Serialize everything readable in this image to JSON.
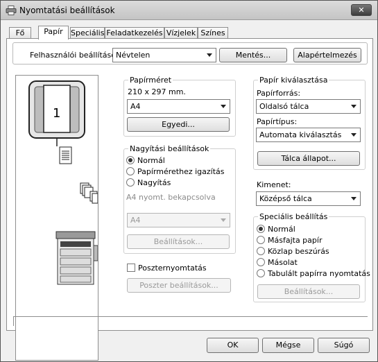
{
  "window": {
    "title": "Nyomtatási beállítások",
    "close_glyph": "✕"
  },
  "tabs": [
    "Fő",
    "Papír",
    "Speciális",
    "Feladatkezelés",
    "Vízjelek",
    "Színes"
  ],
  "user_settings": {
    "label": "Felhasználói beállítások:",
    "value": "Névtelen",
    "save_label": "Mentés...",
    "default_label": "Alapértelmezés"
  },
  "preview": {
    "page_number": "1"
  },
  "paper_size": {
    "title": "Papírméret",
    "dimensions": "210 x 297 mm.",
    "value": "A4",
    "custom_label": "Egyedi..."
  },
  "zoom": {
    "title": "Nagyítási beállítások",
    "options": [
      "Normál",
      "Papírmérethez igazítás",
      "Nagyítás"
    ],
    "selected": "Normál",
    "status": "A4 nyomt. bekapcsolva",
    "size_value": "A4",
    "settings_label": "Beállítások..."
  },
  "poster": {
    "checkbox_label": "Poszternyomtatás",
    "settings_label": "Poszter beállítások..."
  },
  "paper_selection": {
    "title": "Papír kiválasztása",
    "source_label": "Papírforrás:",
    "source_value": "Oldalsó tálca",
    "type_label": "Papírtípus:",
    "type_value": "Automata kiválasztás",
    "tray_status_label": "Tálca állapot..."
  },
  "output": {
    "label": "Kimenet:",
    "value": "Középső tálca"
  },
  "special": {
    "title": "Speciális beállítás",
    "options": [
      "Normál",
      "Másfajta papír",
      "Közlap beszúrás",
      "Másolat",
      "Tabulált papírra nyomtatás"
    ],
    "selected": "Normál",
    "settings_label": "Beállítások..."
  },
  "footer": {
    "ok_label": "OK",
    "cancel_label": "Mégse",
    "help_label": "Súgó"
  }
}
